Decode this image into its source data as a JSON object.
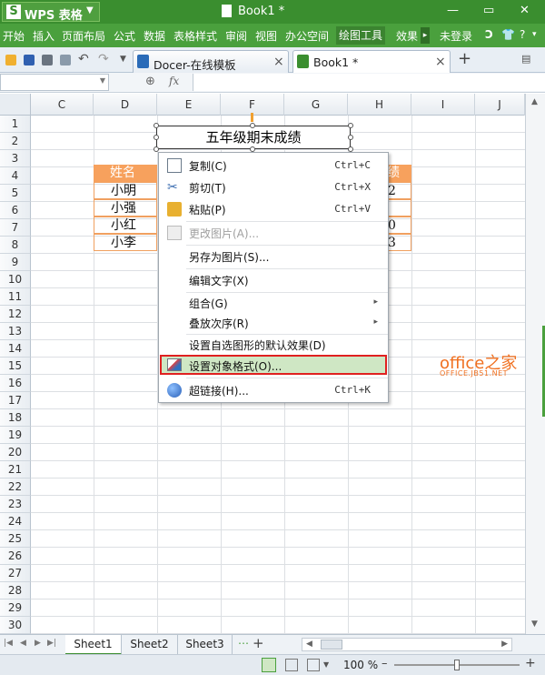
{
  "titlebar": {
    "app_name": "WPS 表格",
    "doc_title": "Book1 *",
    "logo": "S",
    "colors": {
      "bar": "#3a8e2f"
    }
  },
  "menubar": {
    "items": [
      "开始",
      "插入",
      "页面布局",
      "公式",
      "数据",
      "表格样式",
      "审阅",
      "视图",
      "办公空间",
      "绘图工具",
      "效果"
    ],
    "active": "绘图工具",
    "login": "未登录"
  },
  "tabs": [
    {
      "label": "Docer-在线模板"
    },
    {
      "label": "Book1 *"
    }
  ],
  "formula_bar": {
    "fx": "fx"
  },
  "columns": [
    "C",
    "D",
    "E",
    "F",
    "G",
    "H",
    "I",
    "J"
  ],
  "rows": [
    "1",
    "2",
    "3",
    "4",
    "5",
    "6",
    "7",
    "8",
    "9",
    "10",
    "11",
    "12",
    "13",
    "14",
    "15",
    "16",
    "17",
    "18",
    "19",
    "20",
    "21",
    "22",
    "23",
    "24",
    "25",
    "26",
    "27",
    "28",
    "29",
    "30"
  ],
  "cells": {
    "header_name": "姓名",
    "names": [
      "小明",
      "小强",
      "小红",
      "小李"
    ],
    "h_partial": [
      "绩",
      "2",
      "",
      "0",
      "3"
    ]
  },
  "textbox": "五年级期末成绩",
  "context_menu": [
    {
      "label": "复制(C)",
      "shortcut": "Ctrl+C",
      "icon": "copy-icon"
    },
    {
      "label": "剪切(T)",
      "shortcut": "Ctrl+X",
      "icon": "cut-icon"
    },
    {
      "label": "粘贴(P)",
      "shortcut": "Ctrl+V",
      "icon": "paste-icon"
    },
    {
      "label": "更改图片(A)...",
      "shortcut": "",
      "icon": "change-picture-icon",
      "disabled": true
    },
    {
      "label": "另存为图片(S)...",
      "shortcut": ""
    },
    {
      "label": "编辑文字(X)",
      "shortcut": ""
    },
    {
      "label": "组合(G)",
      "shortcut": "",
      "submenu": true
    },
    {
      "label": "叠放次序(R)",
      "shortcut": "",
      "submenu": true
    },
    {
      "label": "设置自选图形的默认效果(D)",
      "shortcut": ""
    },
    {
      "label": "设置对象格式(O)...",
      "shortcut": "",
      "icon": "format-object-icon",
      "highlighted": true
    },
    {
      "label": "超链接(H)...",
      "shortcut": "Ctrl+K",
      "icon": "hyperlink-icon"
    }
  ],
  "sheets": [
    "Sheet1",
    "Sheet2",
    "Sheet3"
  ],
  "active_sheet": "Sheet1",
  "status": {
    "zoom": "100 %"
  },
  "watermark": {
    "main": "office之家",
    "sub": "OFFICE.JB51.NET"
  }
}
